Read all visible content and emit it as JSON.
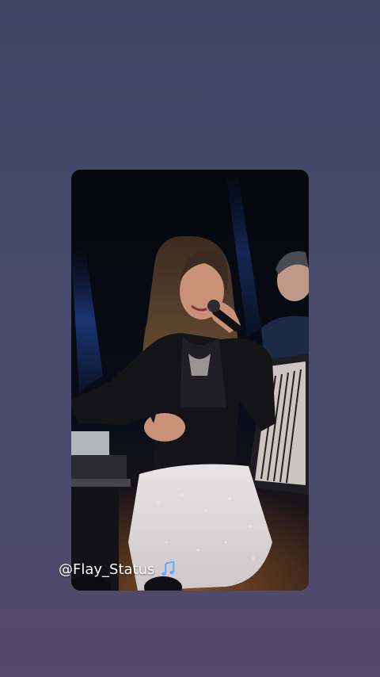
{
  "story": {
    "mention_text": "@Flay_Status",
    "sticker_icon": "music-note-icon",
    "background_gradient": [
      "#3d4565",
      "#53496a"
    ]
  }
}
